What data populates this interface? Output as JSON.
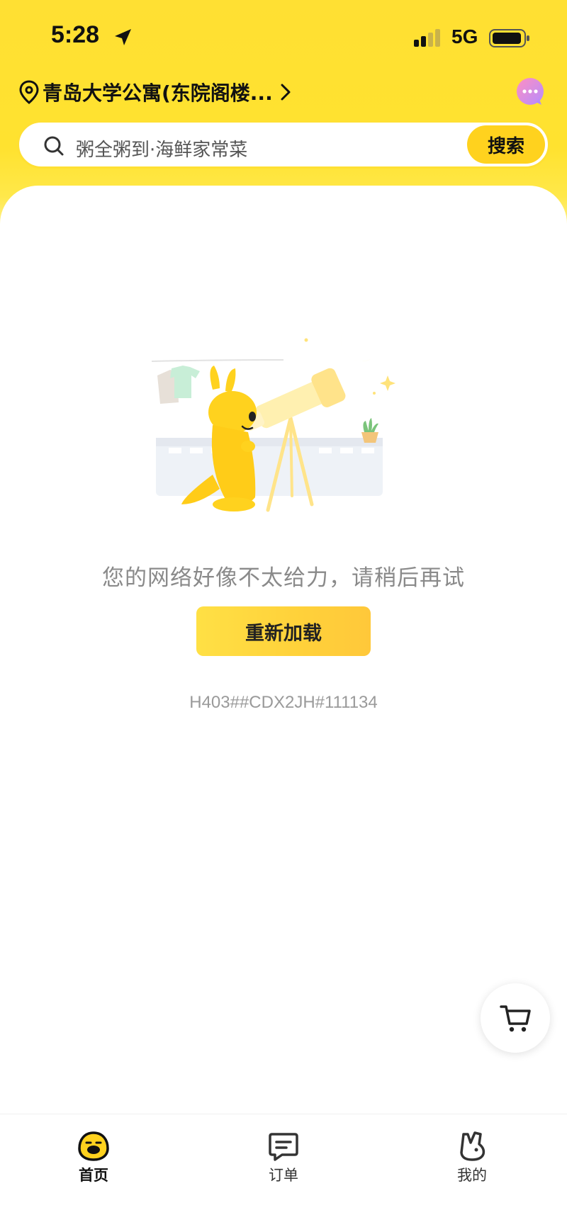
{
  "status_bar": {
    "time": "5:28",
    "network": "5G"
  },
  "header": {
    "address": "青岛大学公寓(东院阁楼...",
    "search": {
      "placeholder": "粥全粥到·海鲜家常菜",
      "button_label": "搜索"
    }
  },
  "content": {
    "error_message": "您的网络好像不太给力，请稍后再试",
    "reload_label": "重新加载",
    "error_code": "H403##CDX2JH#111134"
  },
  "tabs": [
    {
      "label": "首页",
      "icon": "home-duck-icon",
      "active": true
    },
    {
      "label": "订单",
      "icon": "order-icon",
      "active": false
    },
    {
      "label": "我的",
      "icon": "profile-icon",
      "active": false
    }
  ],
  "colors": {
    "brand_yellow": "#ffd21e",
    "header_yellow": "#ffe033"
  }
}
